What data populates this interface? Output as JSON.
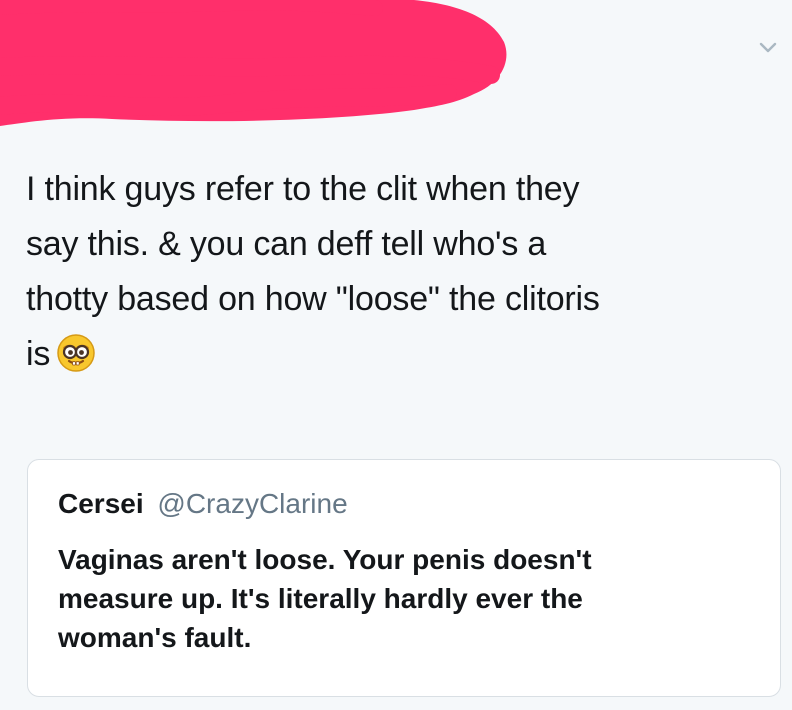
{
  "tweet": {
    "author_redacted": true,
    "redaction_color": "#ff2f6b",
    "menu_icon": "chevron-down-icon",
    "text": "I think guys refer to the clit when they\nsay this. & you can deff tell who's a\nthotty based on how \"loose\" the clitoris\nis",
    "emoji": "nerd-face"
  },
  "quoted_tweet": {
    "display_name": "Cersei",
    "handle": "@CrazyClarine",
    "text": "Vaginas aren't loose. Your penis doesn't\nmeasure up. It's literally hardly ever the\nwoman's fault."
  }
}
